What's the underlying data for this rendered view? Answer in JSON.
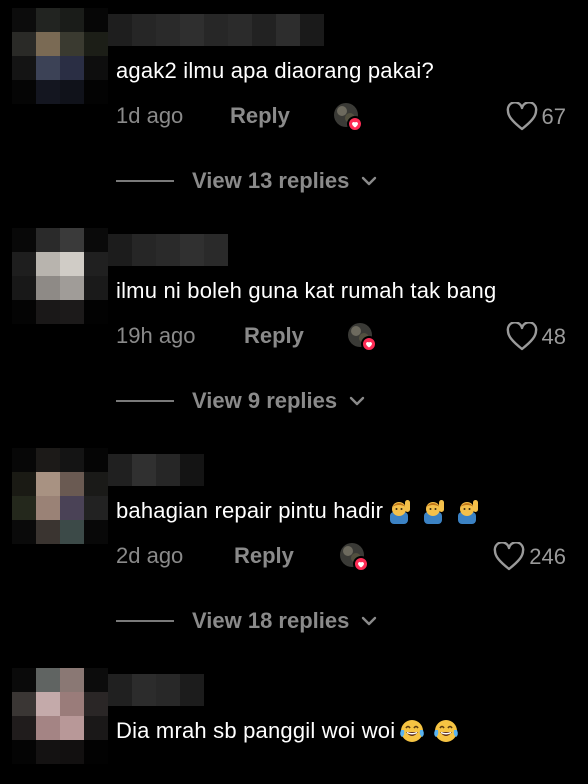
{
  "comments": [
    {
      "text": "agak2 ilmu apa diaorang pakai?",
      "time": "1d ago",
      "reply_label": "Reply",
      "likes": "67",
      "view_replies": "View 13 replies",
      "emojis": []
    },
    {
      "text": "ilmu ni boleh guna kat rumah tak bang",
      "time": "19h ago",
      "reply_label": "Reply",
      "likes": "48",
      "view_replies": "View 9 replies",
      "emojis": []
    },
    {
      "text": "bahagian repair pintu hadir",
      "time": "2d ago",
      "reply_label": "Reply",
      "likes": "246",
      "view_replies": "View 18 replies",
      "emojis": [
        "raising-hand-emoji",
        "raising-hand-emoji",
        "raising-hand-emoji"
      ]
    },
    {
      "text": "Dia mrah sb panggil woi woi",
      "emojis": [
        "tears-of-joy-emoji",
        "tears-of-joy-emoji"
      ]
    }
  ],
  "icons": {
    "like": "heart-outline-icon",
    "creator_liked": "creator-liked-avatar-icon",
    "expand": "chevron-down-icon"
  },
  "colors": {
    "background": "#000000",
    "primary_text": "#ffffff",
    "secondary_text": "#8a8a8a",
    "creator_badge": "#fe2c55"
  }
}
